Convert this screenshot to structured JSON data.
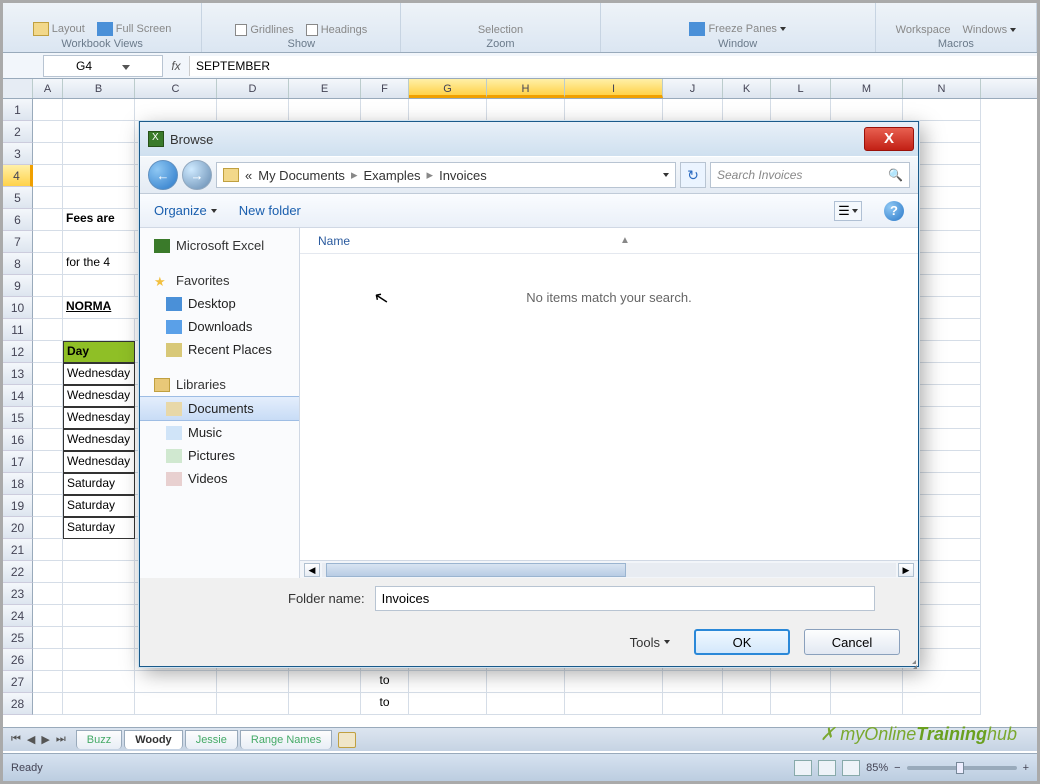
{
  "ribbon": {
    "groups": [
      {
        "label": "Workbook Views",
        "items": [
          "Layout",
          "Full Screen"
        ]
      },
      {
        "label": "Show",
        "items": [
          "Gridlines",
          "Headings"
        ]
      },
      {
        "label": "Zoom",
        "items": [
          "Selection"
        ]
      },
      {
        "label": "Window",
        "items": [
          "Freeze Panes"
        ]
      },
      {
        "label": "Macros",
        "items": [
          "Workspace",
          "Windows"
        ]
      }
    ]
  },
  "namebox": "G4",
  "formula": "SEPTEMBER",
  "columns": [
    "A",
    "B",
    "C",
    "D",
    "E",
    "F",
    "G",
    "H",
    "I",
    "J",
    "K",
    "L",
    "M",
    "N"
  ],
  "selected_cols": [
    "G",
    "H",
    "I"
  ],
  "selected_row": 4,
  "row_count": 28,
  "sheet": {
    "fees_text": "Fees are",
    "for_text": "for the 4",
    "normal": "NORMA",
    "day_hdr": "Day",
    "days": [
      "Wednesday",
      "Wednesday",
      "Wednesday",
      "Wednesday",
      "Wednesday",
      "Saturday",
      "Saturday",
      "Saturday"
    ],
    "to": "to"
  },
  "tabs": {
    "items": [
      "Buzz",
      "Woody",
      "Jessie",
      "Range Names"
    ],
    "active": "Woody"
  },
  "status": {
    "ready": "Ready",
    "zoom": "85%"
  },
  "dialog": {
    "title": "Browse",
    "crumbs": [
      "My Documents",
      "Examples",
      "Invoices"
    ],
    "crumb_prefix": "«",
    "search_placeholder": "Search Invoices",
    "organize": "Organize",
    "newfolder": "New folder",
    "tree": {
      "excel": "Microsoft Excel",
      "fav": "Favorites",
      "desk": "Desktop",
      "dl": "Downloads",
      "rp": "Recent Places",
      "lib": "Libraries",
      "doc": "Documents",
      "mus": "Music",
      "pic": "Pictures",
      "vid": "Videos"
    },
    "col_name": "Name",
    "empty": "No items match your search.",
    "folder_label": "Folder name:",
    "folder_value": "Invoices",
    "tools": "Tools",
    "ok": "OK",
    "cancel": "Cancel"
  },
  "watermark": {
    "a": "myOnline",
    "b": "Training",
    "c": "hub"
  }
}
